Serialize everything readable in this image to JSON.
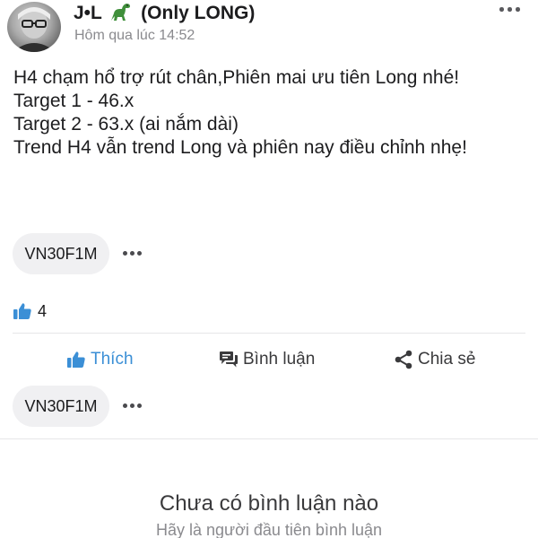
{
  "post": {
    "author_name_prefix": "J•L",
    "author_name_suffix": "(Only LONG)",
    "timestamp": "Hôm qua lúc 14:52",
    "body_lines": [
      "H4 chạm hổ trợ rút chân,Phiên mai ưu tiên Long nhé!",
      "Target 1 - 46.x",
      "Target 2 - 63.x (ai nắm dài)",
      "Trend H4 vẫn trend Long và phiên nay điều chỉnh nhẹ!"
    ],
    "tags": [
      "VN30F1M",
      "VN30F1M"
    ],
    "like_count": "4"
  },
  "actions": {
    "like_label": "Thích",
    "comment_label": "Bình luận",
    "share_label": "Chia sẻ"
  },
  "comments_empty": {
    "title": "Chưa có bình luận nào",
    "subtitle": "Hãy là người đầu tiên bình luận"
  },
  "icons": {
    "author_emoji": "dinosaur-icon",
    "more": "more-horizontal-icon",
    "like": "thumbs-up-icon",
    "comment": "comment-bubble-icon",
    "share": "share-icon"
  },
  "colors": {
    "accent_blue": "#3b8fd6",
    "text": "#1c1c1e",
    "muted": "#8a8a8e",
    "chip_bg": "#f0f0f2"
  }
}
